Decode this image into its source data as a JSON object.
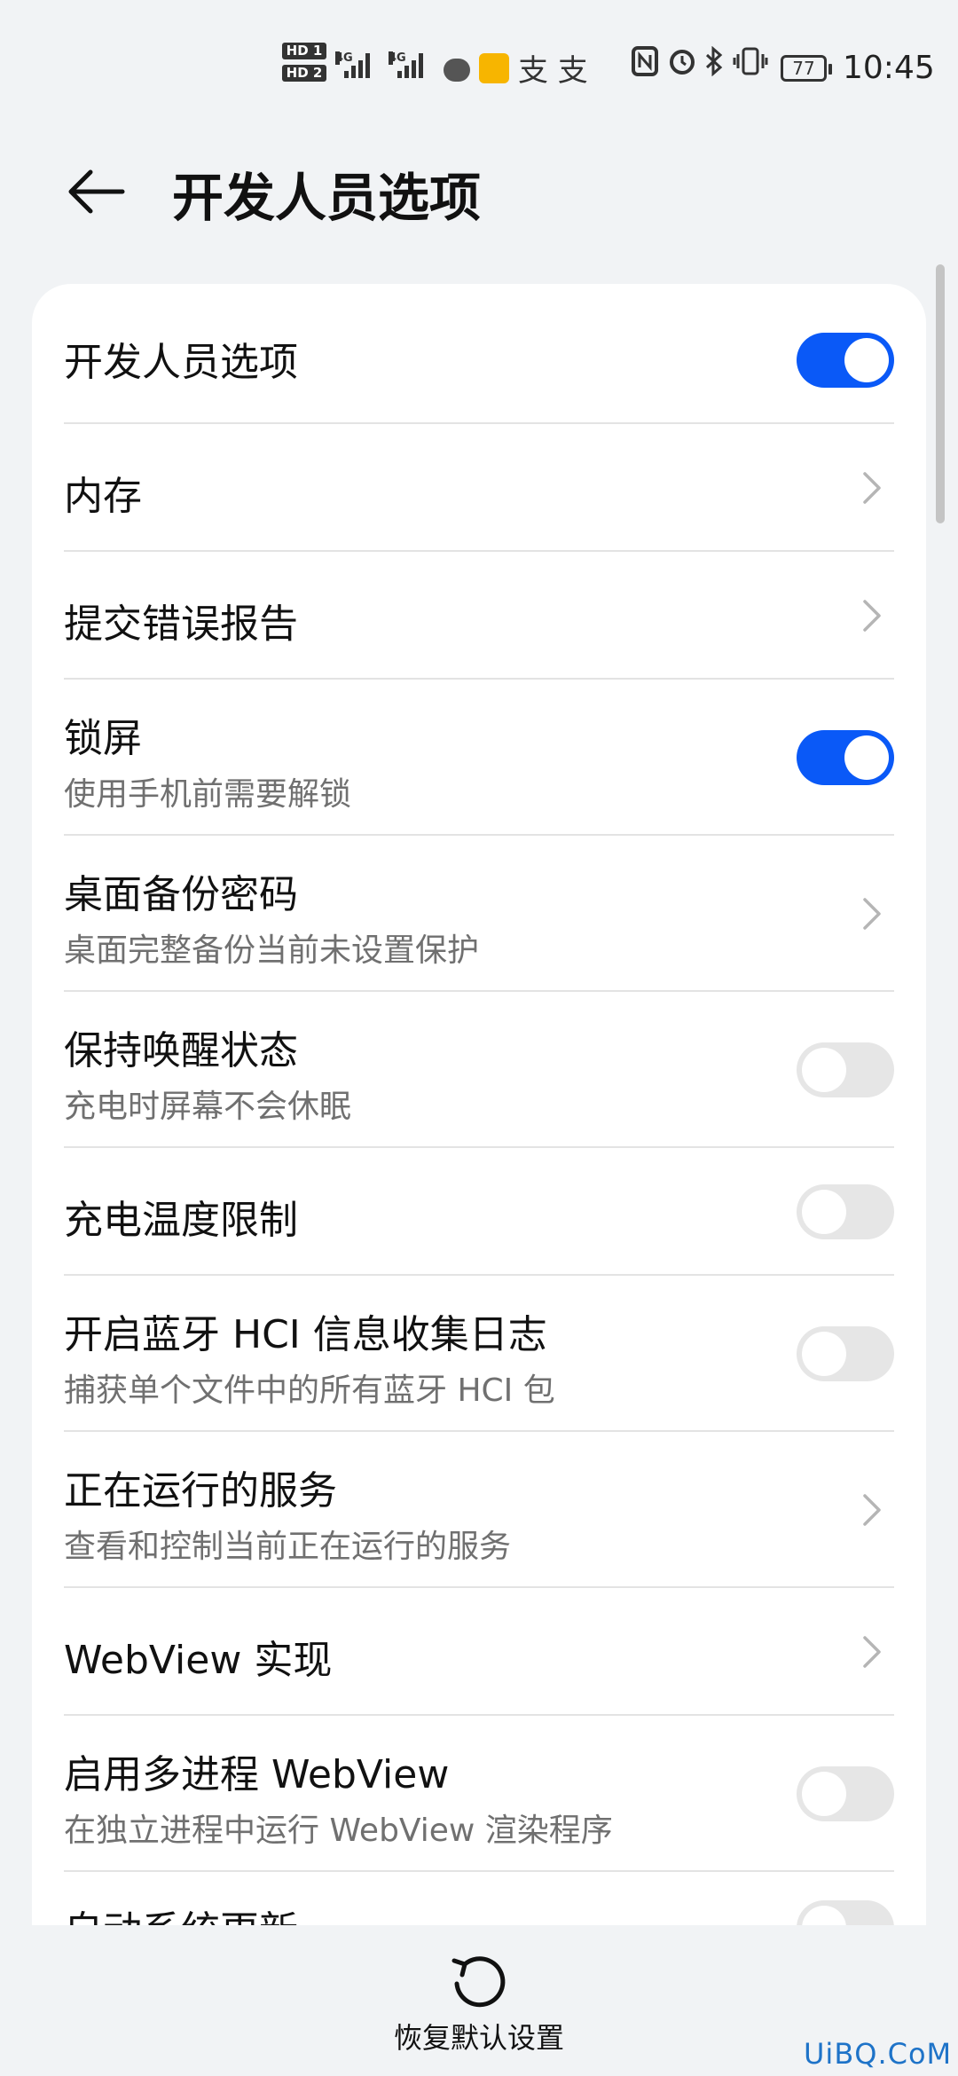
{
  "status_bar": {
    "sim1_label": "HD 1",
    "sim2_label": "HD 2",
    "net1": "4G",
    "net2": "4G",
    "battery": "77",
    "time": "10:45",
    "chars": "支 支"
  },
  "header": {
    "title": "开发人员选项"
  },
  "settings": {
    "items": [
      {
        "title": "开发人员选项",
        "subtitle": "",
        "control": "toggle",
        "state": "on"
      },
      {
        "title": "内存",
        "subtitle": "",
        "control": "chevron"
      },
      {
        "title": "提交错误报告",
        "subtitle": "",
        "control": "chevron"
      },
      {
        "title": "锁屏",
        "subtitle": "使用手机前需要解锁",
        "control": "toggle",
        "state": "on"
      },
      {
        "title": "桌面备份密码",
        "subtitle": "桌面完整备份当前未设置保护",
        "control": "chevron"
      },
      {
        "title": "保持唤醒状态",
        "subtitle": "充电时屏幕不会休眠",
        "control": "toggle",
        "state": "off"
      },
      {
        "title": "充电温度限制",
        "subtitle": "",
        "control": "toggle",
        "state": "off"
      },
      {
        "title": "开启蓝牙 HCI 信息收集日志",
        "subtitle": "捕获单个文件中的所有蓝牙 HCI 包",
        "control": "toggle",
        "state": "off"
      },
      {
        "title": "正在运行的服务",
        "subtitle": "查看和控制当前正在运行的服务",
        "control": "chevron"
      },
      {
        "title": "WebView 实现",
        "subtitle": "",
        "control": "chevron"
      },
      {
        "title": "启用多进程 WebView",
        "subtitle": "在独立进程中运行 WebView 渲染程序",
        "control": "toggle",
        "state": "off"
      },
      {
        "title": "自动系统更新",
        "subtitle": "",
        "control": "toggle",
        "state": "off"
      }
    ]
  },
  "bottom": {
    "reset_label": "恢复默认设置"
  },
  "watermark": "UiBQ.CoM",
  "colors": {
    "accent": "#0a59f7",
    "background": "#f1f3f5",
    "card": "#ffffff"
  }
}
